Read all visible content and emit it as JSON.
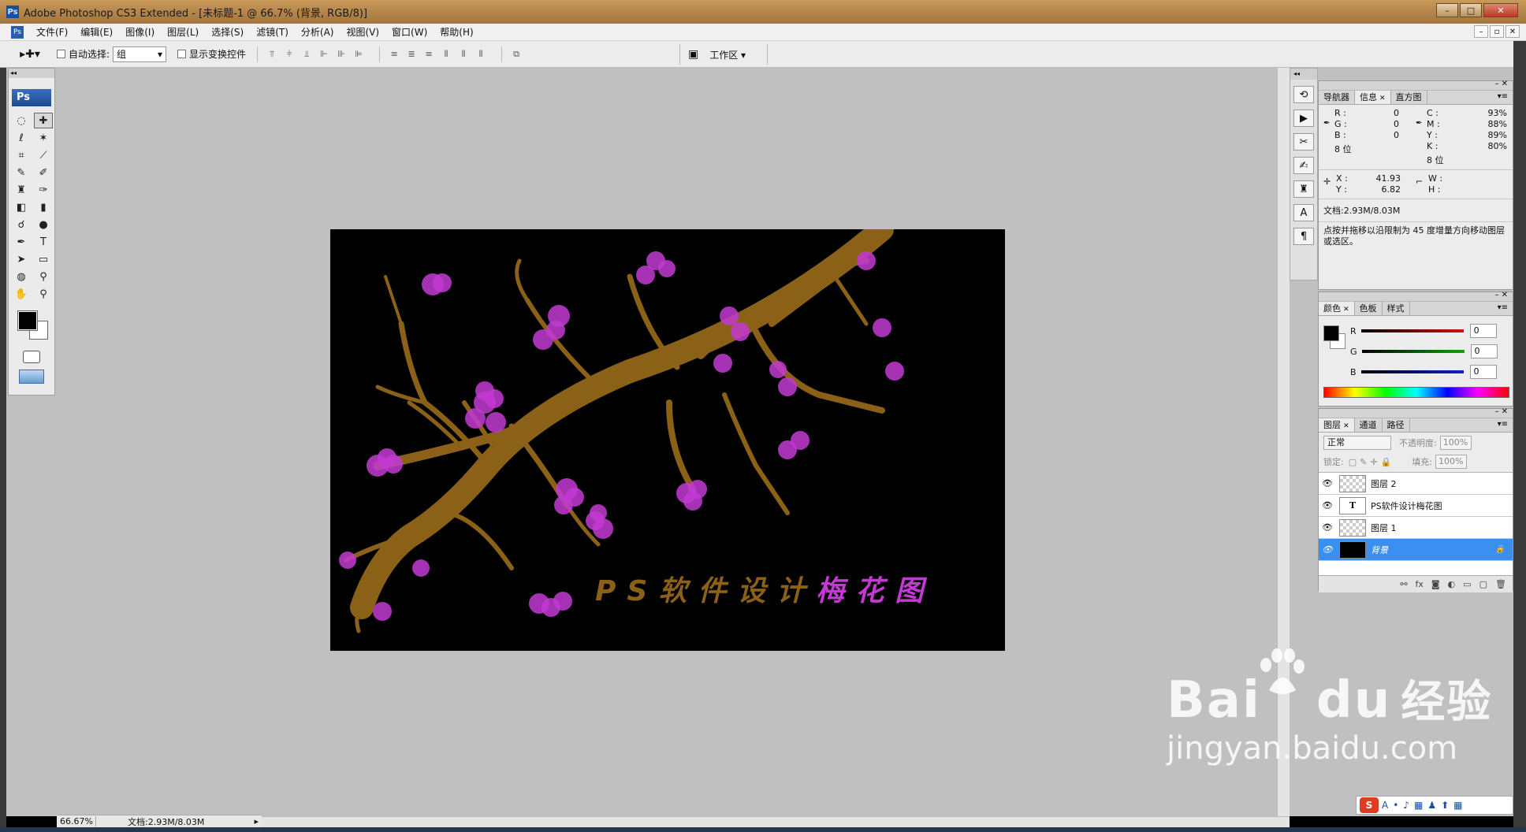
{
  "window": {
    "app_logo": "Ps",
    "title": "Adobe Photoshop CS3 Extended - [未标题-1 @ 66.7% (背景, RGB/8)]",
    "controls": [
      "–",
      "□",
      "✕"
    ]
  },
  "menubar": {
    "doc_icon": "Ps",
    "items": [
      "文件(F)",
      "编辑(E)",
      "图像(I)",
      "图层(L)",
      "选择(S)",
      "滤镜(T)",
      "分析(A)",
      "视图(V)",
      "窗口(W)",
      "帮助(H)"
    ],
    "mdi_controls": [
      "–",
      "▫",
      "✕"
    ]
  },
  "options": {
    "tool_icon": "move-tool-icon",
    "tool_glyph": "▸✚▾",
    "auto_select_label": "自动选择:",
    "auto_select_value": "组",
    "show_transform_label": "显示变换控件",
    "workspace_label": "工作区 ▾",
    "workspace_glyph": "▣"
  },
  "toolbox": {
    "collapse": "◂◂",
    "logo": "Ps",
    "tools": [
      {
        "name": "marquee-tool-icon",
        "glyph": "◌",
        "active": false
      },
      {
        "name": "move-tool-icon",
        "glyph": "✚",
        "active": true
      },
      {
        "name": "lasso-tool-icon",
        "glyph": "ℓ",
        "active": false
      },
      {
        "name": "magic-wand-tool-icon",
        "glyph": "✶",
        "active": false
      },
      {
        "name": "crop-tool-icon",
        "glyph": "⌗",
        "active": false
      },
      {
        "name": "slice-tool-icon",
        "glyph": "⟋",
        "active": false
      },
      {
        "name": "healing-brush-tool-icon",
        "glyph": "✎",
        "active": false
      },
      {
        "name": "brush-tool-icon",
        "glyph": "✐",
        "active": false
      },
      {
        "name": "clone-stamp-tool-icon",
        "glyph": "♜",
        "active": false
      },
      {
        "name": "history-brush-tool-icon",
        "glyph": "✑",
        "active": false
      },
      {
        "name": "eraser-tool-icon",
        "glyph": "◧",
        "active": false
      },
      {
        "name": "gradient-tool-icon",
        "glyph": "▮",
        "active": false
      },
      {
        "name": "blur-tool-icon",
        "glyph": "☌",
        "active": false
      },
      {
        "name": "dodge-tool-icon",
        "glyph": "●",
        "active": false
      },
      {
        "name": "pen-tool-icon",
        "glyph": "✒",
        "active": false
      },
      {
        "name": "type-tool-icon",
        "glyph": "T",
        "active": false
      },
      {
        "name": "path-selection-tool-icon",
        "glyph": "➤",
        "active": false
      },
      {
        "name": "shape-tool-icon",
        "glyph": "▭",
        "active": false
      },
      {
        "name": "3d-rotate-tool-icon",
        "glyph": "◍",
        "active": false
      },
      {
        "name": "eyedropper-tool-icon",
        "glyph": "⚲",
        "active": false
      },
      {
        "name": "hand-tool-icon",
        "glyph": "✋",
        "active": false
      },
      {
        "name": "zoom-tool-icon",
        "glyph": "⚲",
        "active": false
      }
    ]
  },
  "canvas": {
    "text_part1": "PS软件设计",
    "text_part2": "梅花图",
    "branch_color": "#8b6117",
    "blossom_color": "#c23ad2"
  },
  "status": {
    "zoom": "66.67%",
    "doc": "文档:2.93M/8.03M",
    "arrow": "▸"
  },
  "icon_strip": {
    "handle": "◂◂",
    "icons": [
      {
        "name": "history-icon",
        "glyph": "⟲"
      },
      {
        "name": "actions-icon",
        "glyph": "▶"
      },
      {
        "name": "tool-presets-icon",
        "glyph": "✂"
      },
      {
        "name": "brushes-icon",
        "glyph": "✍"
      },
      {
        "name": "clone-source-icon",
        "glyph": "♜"
      },
      {
        "name": "character-icon",
        "glyph": "A"
      },
      {
        "name": "paragraph-icon",
        "glyph": "¶"
      }
    ]
  },
  "info_panel": {
    "tabs": [
      "导航器",
      "信息",
      "直方图"
    ],
    "rgb": [
      {
        "label": "R :",
        "value": "0"
      },
      {
        "label": "G :",
        "value": "0"
      },
      {
        "label": "B :",
        "value": "0"
      }
    ],
    "cmyk": [
      {
        "label": "C :",
        "value": "93%"
      },
      {
        "label": "M :",
        "value": "88%"
      },
      {
        "label": "Y :",
        "value": "89%"
      },
      {
        "label": "K :",
        "value": "80%"
      }
    ],
    "bits_left": "8 位",
    "bits_right": "8 位",
    "xy": [
      {
        "label": "X :",
        "value": "41.93"
      },
      {
        "label": "Y :",
        "value": "6.82"
      }
    ],
    "wh": [
      {
        "label": "W :",
        "value": ""
      },
      {
        "label": "H :",
        "value": ""
      }
    ],
    "doc": "文档:2.93M/8.03M",
    "hint": "点按并拖移以沿限制为 45 度增量方向移动图层或选区。"
  },
  "color_panel": {
    "tabs": [
      "颜色",
      "色板",
      "样式"
    ],
    "channels": [
      {
        "label": "R",
        "value": "0",
        "color": "#d41010"
      },
      {
        "label": "G",
        "value": "0",
        "color": "#10a010"
      },
      {
        "label": "B",
        "value": "0",
        "color": "#1020c8"
      }
    ]
  },
  "layers_panel": {
    "tabs": [
      "图层",
      "通道",
      "路径"
    ],
    "blend_mode": "正常",
    "opacity_label": "不透明度:",
    "opacity": "100%",
    "lock_label": "锁定:",
    "fill_label": "填充:",
    "fill": "100%",
    "layers": [
      {
        "name": "图层 2",
        "kind": "pixel",
        "selected": false
      },
      {
        "name": "PS软件设计梅花图",
        "kind": "type",
        "selected": false
      },
      {
        "name": "图层 1",
        "kind": "pixel",
        "selected": false
      },
      {
        "name": "背景",
        "kind": "background",
        "selected": true
      }
    ],
    "footer_icons": [
      "⚯",
      "fx",
      "◙",
      "◐",
      "▭",
      "▢",
      "🗑"
    ]
  },
  "watermark": {
    "brand": "Bai",
    "brand_tail": "du",
    "brand_cn": "经验",
    "url": "jingyan.baidu.com"
  },
  "tray": {
    "logo": "S",
    "items": [
      "A",
      "•",
      "♪",
      "▦",
      "♟",
      "⬆",
      "▦"
    ]
  }
}
